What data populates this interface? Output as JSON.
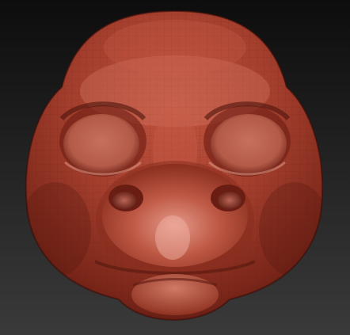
{
  "viewport": {
    "background_top": "#0d0d0d",
    "background_bottom": "#3a3a3a"
  },
  "model": {
    "subject": "sculpted-creature-head-mesh",
    "material_color": "#a54030",
    "highlight_color": "#e49a86",
    "shadow_color": "#4c140c",
    "wireframe_color": "#5a1a10",
    "wireframe_visible": true
  }
}
